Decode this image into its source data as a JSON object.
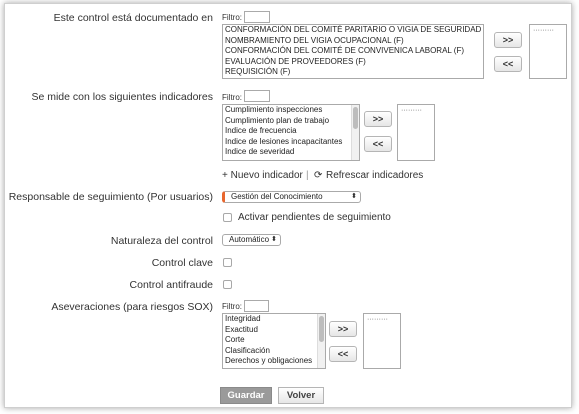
{
  "form": {
    "documented": {
      "label": "Este control está documentado en",
      "filter_label": "Filtro:",
      "options": [
        "CONFORMACIÓN DEL COMITÉ PARITARIO O VIGIA DE SEGURIDAD Y SA",
        "NOMBRAMIENTO DEL VIGIA OCUPACIONAL (F)",
        "CONFORMACIÓN DEL COMITÉ DE CONVIVENICA LABORAL (F)",
        "EVALUACIÓN DE PROVEEDORES (F)",
        "REQUISICIÓN (F)"
      ],
      "add_label": ">>",
      "remove_label": "<<",
      "selected_placeholder": "·········"
    },
    "indicators": {
      "label": "Se mide con los siguientes indicadores",
      "filter_label": "Filtro:",
      "options": [
        "Cumplimiento inspecciones",
        "Cumplimiento plan de trabajo",
        "Indice de frecuencia",
        "Indice de lesiones incapacitantes",
        "Indice de severidad"
      ],
      "add_label": ">>",
      "remove_label": "<<",
      "selected_placeholder": "·········",
      "new_indicator": "+ Nuevo indicador",
      "separator": "|",
      "refresh_icon": "⟳",
      "refresh": "Refrescar indicadores"
    },
    "responsible": {
      "label": "Responsable de seguimiento (Por usuarios)",
      "value": "Gestión del Conocimiento",
      "arrows": "⬍",
      "activate_label": "Activar pendientes de seguimiento"
    },
    "nature": {
      "label": "Naturaleza del control",
      "value": "Automático",
      "arrows": "⬍"
    },
    "key_control": {
      "label": "Control clave"
    },
    "antifraud": {
      "label": "Control antifraude"
    },
    "assertions": {
      "label": "Aseveraciones (para riesgos SOX)",
      "filter_label": "Filtro:",
      "options": [
        "Integridad",
        "Exactitud",
        "Corte",
        "Clasificación",
        "Derechos y obligaciones"
      ],
      "add_label": ">>",
      "remove_label": "<<",
      "selected_placeholder": "·········"
    },
    "actions": {
      "save": "Guardar",
      "back": "Volver"
    }
  },
  "colors": {
    "accent": "#e8672f",
    "save_bg": "#9a9a9a"
  }
}
